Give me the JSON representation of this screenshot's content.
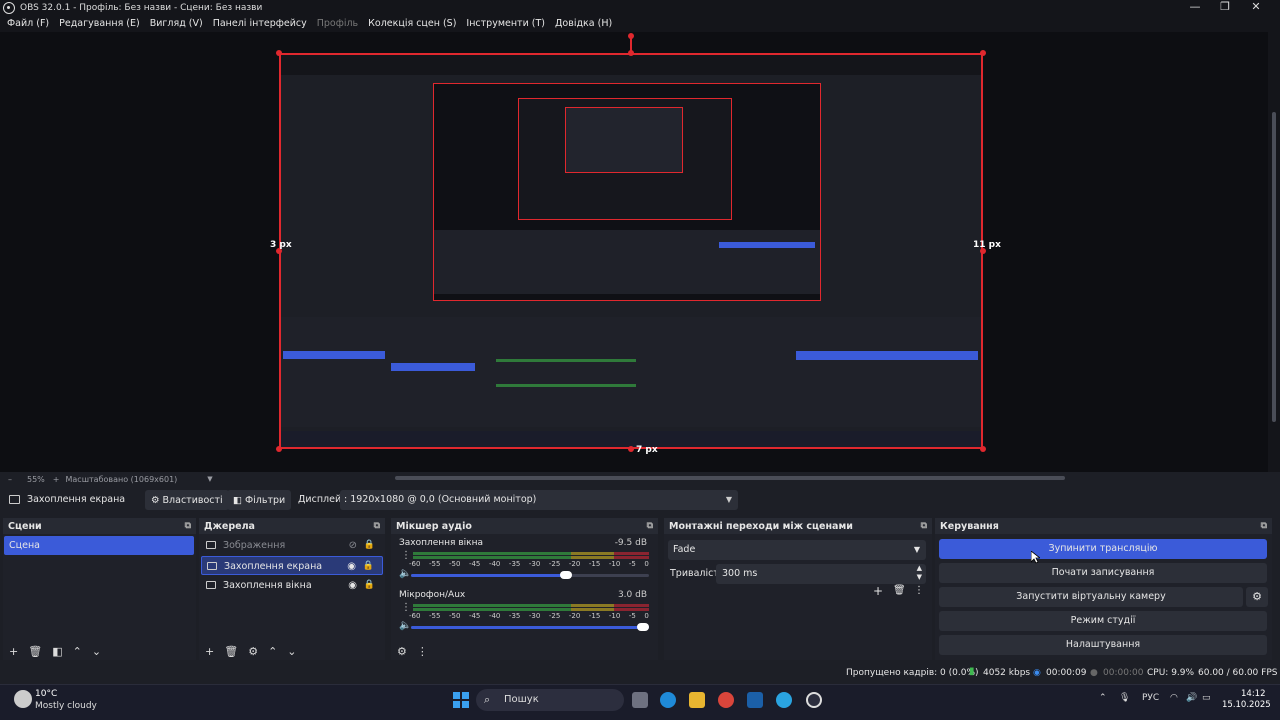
{
  "window": {
    "title": "OBS 32.0.1 - Профіль: Без назви - Сцени: Без назви"
  },
  "menu": {
    "items": [
      "Файл (F)",
      "Редагування (E)",
      "Вигляд (V)",
      "Панелі інтерфейсу",
      "Профіль",
      "Колекція сцен (S)",
      "Інструменти (T)",
      "Довідка (H)"
    ],
    "disabled_item": "Профіль"
  },
  "preview": {
    "left_offset": "3 px",
    "right_offset": "11 px",
    "bottom_offset": "7 px"
  },
  "zoombar": {
    "zoom": "55%",
    "scaled": "Масштабовано (1069x601)"
  },
  "context_bar": {
    "source_name": "Захоплення екрана",
    "properties_label": "Властивості",
    "filters_label": "Фільтри",
    "display_label": "Дисплей",
    "display_value": ": 1920x1080 @ 0,0 (Основний монітор)"
  },
  "docks": {
    "scenes": {
      "title": "Сцени",
      "items": [
        "Сцена"
      ]
    },
    "sources": {
      "title": "Джерела",
      "items": [
        {
          "label": "Зображення",
          "visible": false
        },
        {
          "label": "Захоплення екрана",
          "visible": true,
          "selected": true
        },
        {
          "label": "Захоплення вікна",
          "visible": true
        }
      ]
    },
    "mixer": {
      "title": "Мікшер аудіо",
      "ticks": [
        "-60",
        "-55",
        "-50",
        "-45",
        "-40",
        "-35",
        "-30",
        "-25",
        "-20",
        "-15",
        "-10",
        "-5",
        "0"
      ],
      "channels": [
        {
          "name": "Захоплення вікна",
          "db": "-9.5 dB",
          "volume": 0.65
        },
        {
          "name": "Мікрофон/Aux",
          "db": "3.0 dB",
          "volume": 1.0
        }
      ]
    },
    "transitions": {
      "title": "Монтажні переходи між сценами",
      "selected": "Fade",
      "duration_label": "Тривалість",
      "duration_value": "300 ms"
    },
    "controls": {
      "title": "Керування",
      "stop_stream": "Зупинити трансляцію",
      "start_recording": "Почати записування",
      "start_virtualcam": "Запустити віртуальну камеру",
      "studio_mode": "Режим студії",
      "settings": "Налаштування"
    }
  },
  "statusbar": {
    "dropped_frames": "Пропущено кадрів: 0 (0.0%)",
    "bitrate": "4052 kbps",
    "stream_time": "00:00:09",
    "record_time": "00:00:00",
    "cpu": "CPU: 9.9%",
    "fps": "60.00 / 60.00 FPS"
  },
  "taskbar": {
    "weather_temp": "10°C",
    "weather_desc": "Mostly cloudy",
    "search_placeholder": "Пошук",
    "language": "РУС",
    "time": "14:12",
    "date": "15.10.2025"
  },
  "colors": {
    "accent": "#3b5bd9",
    "selection_red": "#e0282e",
    "background": "#1d1f26"
  }
}
